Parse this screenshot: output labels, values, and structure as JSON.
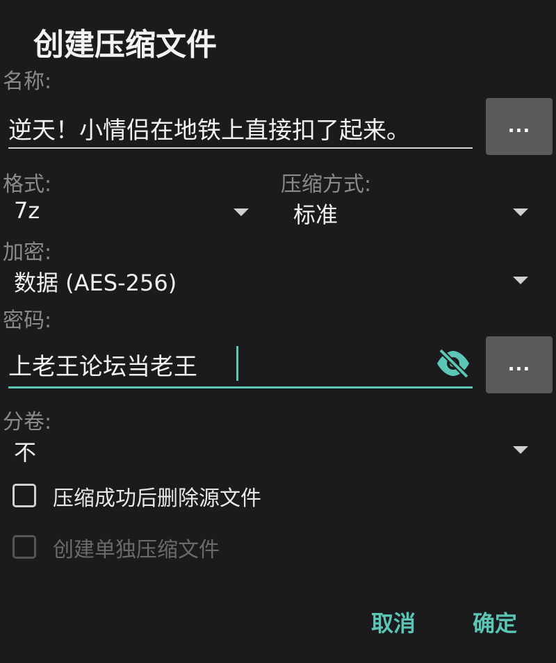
{
  "dialog": {
    "title": "创建压缩文件"
  },
  "name": {
    "label": "名称:",
    "value": "逆天！小情侣在地铁上直接扣了起来。",
    "browse_label": "..."
  },
  "format": {
    "label": "格式:",
    "selected": "7z"
  },
  "compression": {
    "label": "压缩方式:",
    "selected": "标准"
  },
  "encryption": {
    "label": "加密:",
    "selected": "数据 (AES-256)"
  },
  "password": {
    "label": "密码:",
    "value": "上老王论坛当老王",
    "browse_label": "...",
    "visibility_icon": "eye-off-icon"
  },
  "split": {
    "label": "分卷:",
    "selected": "不"
  },
  "options": {
    "delete_source": {
      "label": "压缩成功后删除源文件",
      "checked": false,
      "enabled": true
    },
    "separate_archives": {
      "label": "创建单独压缩文件",
      "checked": false,
      "enabled": false
    }
  },
  "actions": {
    "cancel": "取消",
    "ok": "确定"
  },
  "colors": {
    "background": "#1b1b1d",
    "accent": "#5cc6b6",
    "button": "#5a5a5c",
    "label": "#8a8a8a"
  }
}
